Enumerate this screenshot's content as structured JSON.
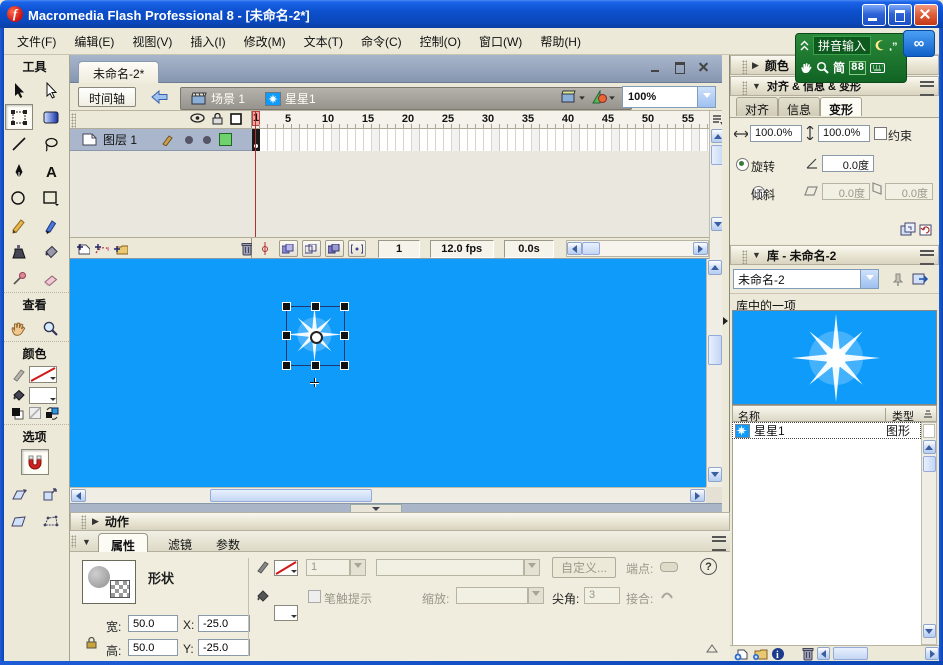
{
  "glyphs": {
    "expanded": "▼",
    "collapsed": "▶",
    "help": "?",
    "back_arrow": "⇦",
    "infinity": "∞",
    "moon": "☾",
    "punct": "’,",
    "up_chevrons": "^",
    "star_char": "*"
  },
  "titlebar": {
    "title": "Macromedia Flash Professional 8 - [未命名-2*]"
  },
  "menubar": {
    "items": [
      "文件(F)",
      "编辑(E)",
      "视图(V)",
      "插入(I)",
      "修改(M)",
      "文本(T)",
      "命令(C)",
      "控制(O)",
      "窗口(W)",
      "帮助(H)"
    ]
  },
  "ime": {
    "label": "拼音输入",
    "simplified": "简",
    "grid": "88"
  },
  "toolbox": {
    "tools_label": "工具",
    "view_label": "查看",
    "colors_label": "颜色",
    "options_label": "选项"
  },
  "document": {
    "tab": "未命名-2*",
    "timeline_toggle": "时间轴",
    "scene": "场景 1",
    "symbol": "星星1",
    "zoom": "100%"
  },
  "timeline": {
    "layer_name": "图层 1",
    "ruler": [
      "1",
      "5",
      "10",
      "15",
      "20",
      "25",
      "30",
      "35",
      "40",
      "45",
      "50",
      "55"
    ],
    "current_frame": "1",
    "frame_rate": "12.0 fps",
    "elapsed_time": "0.0s"
  },
  "properties": {
    "actions_title": "动作",
    "tabs": [
      "属性",
      "滤镜",
      "参数"
    ],
    "shape_label": "形状",
    "width_label": "宽:",
    "width_value": "50.0",
    "height_label": "高:",
    "height_value": "50.0",
    "x_label": "X:",
    "x_value": "-25.0",
    "y_label": "Y:",
    "y_value": "-25.0",
    "stroke_height_value": "1",
    "stroke_hint_label": "笔触提示",
    "custom_button": "自定义...",
    "cap_label": "端点:",
    "scale_label": "缩放:",
    "miter_label": "尖角:",
    "miter_value": "3",
    "join_label": "接合:"
  },
  "right_dock": {
    "color_title": "颜色",
    "align_title": "对齐 & 信息 & 变形",
    "align_tabs": [
      "对齐",
      "信息",
      "变形"
    ],
    "transform": {
      "h_scale": "100.0%",
      "v_scale": "100.0%",
      "constrain_label": "约束",
      "rotate_label": "旋转",
      "rotate_value": "0.0度",
      "skew_label": "倾斜",
      "skew_h_value": "0.0度",
      "skew_v_value": "0.0度"
    },
    "library": {
      "title": "库 - 未命名-2",
      "doc_name": "未命名-2",
      "count_text": "库中的一项",
      "name_col": "名称",
      "type_col": "类型",
      "item_name": "星星1",
      "item_type": "图形"
    }
  },
  "colors": {
    "stage_blue": "#0f9bfa",
    "xp_title_blue": "#0a52cc",
    "layer_outline_green": "#6ed36e",
    "keyframe_red": "#c04040"
  }
}
